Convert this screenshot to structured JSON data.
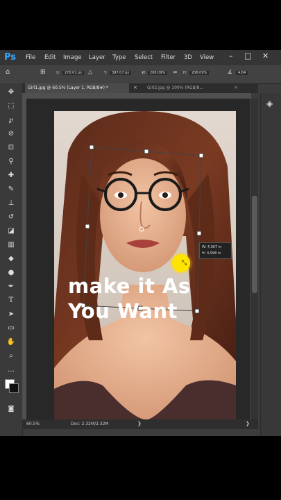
{
  "app": {
    "logo": "Ps"
  },
  "menu": [
    "File",
    "Edit",
    "Image",
    "Layer",
    "Type",
    "Select",
    "Filter",
    "3D",
    "View"
  ],
  "window_controls": [
    "–",
    "□",
    "✕"
  ],
  "options": {
    "x_label": "X:",
    "x_value": "270.01 px",
    "y_label": "Y:",
    "y_value": "397.07 px",
    "w_label": "W:",
    "w_value": "208.09%",
    "h_label": "H:",
    "h_value": "208.09%",
    "angle_value": "4.64"
  },
  "tabs": [
    {
      "label": "Girl1.jpg @ 60.5% (Layer 1, RGB/8#) *",
      "active": true
    },
    {
      "label": "Girl2.jpg @ 100% (RGB/8...",
      "active": false
    }
  ],
  "tools": [
    "move-icon",
    "marquee-icon",
    "lasso-icon",
    "quick-select-icon",
    "crop-icon",
    "eyedropper-icon",
    "healing-icon",
    "brush-icon",
    "clone-stamp-icon",
    "history-brush-icon",
    "eraser-icon",
    "gradient-icon",
    "blur-icon",
    "dodge-icon",
    "pen-icon",
    "type-icon",
    "path-select-icon",
    "rectangle-icon",
    "hand-icon",
    "zoom-icon",
    "more-icon"
  ],
  "transform_readout": {
    "w": "W: 4,067 in",
    "h": "H: 4,998 in"
  },
  "caption": {
    "line1": "make it As",
    "line2": "You Want"
  },
  "status": {
    "zoom": "60.5%",
    "doc": "Doc: 2.32M/2.32M"
  },
  "colors": {
    "accent": "#31a8ff",
    "cursor_highlight": "#ffe400",
    "caption": "#ffffff"
  }
}
